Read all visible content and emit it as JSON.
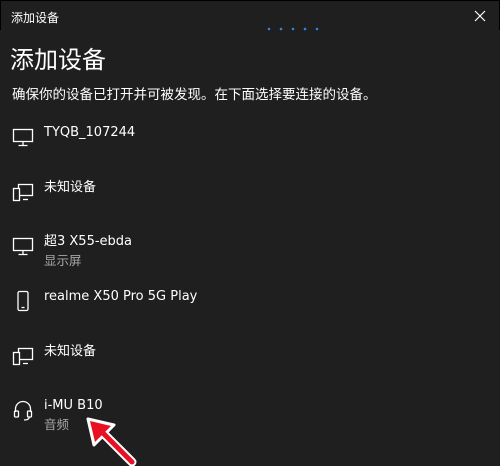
{
  "window": {
    "title": "添加设备"
  },
  "heading": "添加设备",
  "instructions": "确保你的设备已打开并可被发现。在下面选择要连接的设备。",
  "devices": [
    {
      "name": "TYQB_107244",
      "subtitle": "",
      "icon": "monitor-icon"
    },
    {
      "name": "未知设备",
      "subtitle": "",
      "icon": "generic-device-icon"
    },
    {
      "name": "超3 X55-ebda",
      "subtitle": "显示屏",
      "icon": "monitor-icon"
    },
    {
      "name": "realme X50 Pro 5G Play",
      "subtitle": "",
      "icon": "phone-icon"
    },
    {
      "name": "未知设备",
      "subtitle": "",
      "icon": "generic-device-icon"
    },
    {
      "name": "i-MU B10",
      "subtitle": "音频",
      "icon": "headset-icon"
    }
  ],
  "colors": {
    "background": "#1f1f1f",
    "text": "#ffffff",
    "subtext": "#a6a6a6",
    "accent": "#2b88d8",
    "annotation_arrow": "#e81123"
  }
}
